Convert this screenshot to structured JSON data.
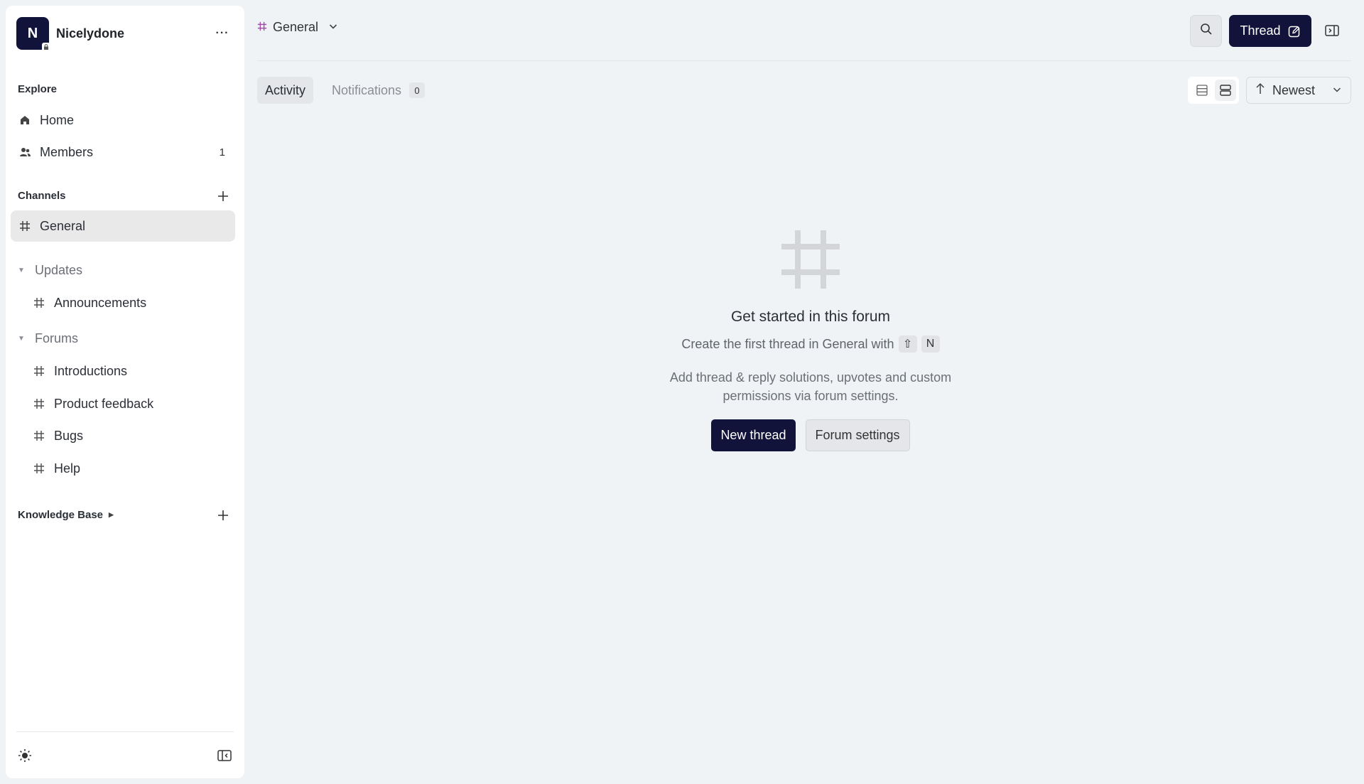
{
  "workspace": {
    "initial": "N",
    "name": "Nicelydone",
    "more_label": "···"
  },
  "sidebar": {
    "explore_label": "Explore",
    "home_label": "Home",
    "members_label": "Members",
    "members_count": "1",
    "channels_label": "Channels",
    "general_label": "General",
    "updates_group": "Updates",
    "announcements_label": "Announcements",
    "forums_group": "Forums",
    "forum_items": [
      "Introductions",
      "Product feedback",
      "Bugs",
      "Help"
    ],
    "knowledge_base_label": "Knowledge Base"
  },
  "header": {
    "channel_name": "General",
    "thread_button": "Thread"
  },
  "tabs": {
    "activity": "Activity",
    "notifications": "Notifications",
    "notifications_count": "0"
  },
  "sort": {
    "label": "Newest"
  },
  "empty_state": {
    "title": "Get started in this forum",
    "line_prefix": "Create the first thread in General with",
    "shortcut_key_1": "⇧",
    "shortcut_key_2": "N",
    "description": "Add thread & reply solutions, upvotes and custom permissions via forum settings.",
    "primary_button": "New thread",
    "secondary_button": "Forum settings"
  },
  "colors": {
    "brand": "#12133b",
    "channel_hash": "#a24fa8",
    "background": "#f0f3f6"
  }
}
